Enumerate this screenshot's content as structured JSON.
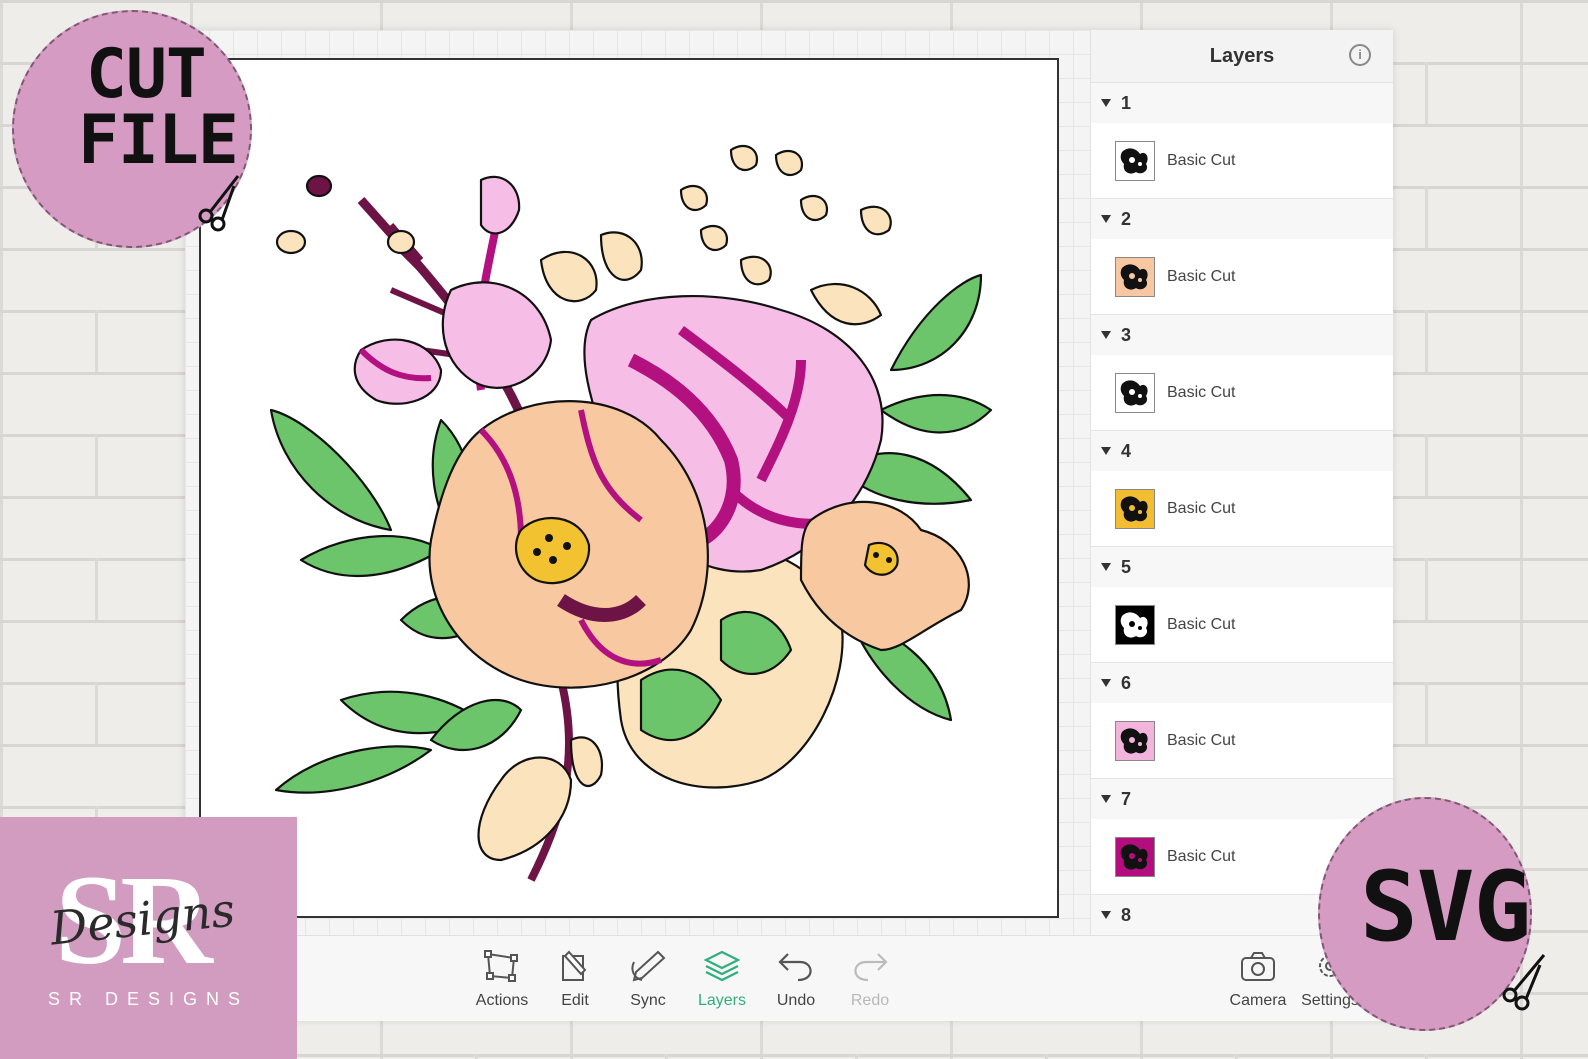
{
  "panel": {
    "title": "Layers",
    "info_icon": "info-icon",
    "groups": [
      {
        "number": "1",
        "layer": "Basic Cut",
        "thumb_color": "#ffffff"
      },
      {
        "number": "2",
        "layer": "Basic Cut",
        "thumb_color": "#f7c7a1"
      },
      {
        "number": "3",
        "layer": "Basic Cut",
        "thumb_color": "#ffffff"
      },
      {
        "number": "4",
        "layer": "Basic Cut",
        "thumb_color": "#f3bd32"
      },
      {
        "number": "5",
        "layer": "Basic Cut",
        "thumb_color": "#000000"
      },
      {
        "number": "6",
        "layer": "Basic Cut",
        "thumb_color": "#f2b4dc"
      },
      {
        "number": "7",
        "layer": "Basic Cut",
        "thumb_color": "#b30d7e"
      },
      {
        "number": "8"
      }
    ]
  },
  "toolbar": {
    "actions": "Actions",
    "edit": "Edit",
    "sync": "Sync",
    "layers": "Layers",
    "undo": "Undo",
    "redo": "Redo",
    "camera": "Camera",
    "settings": "Settings"
  },
  "badges": {
    "cut_file_line1": "CUT",
    "cut_file_line2": "FILE",
    "svg": "SVG"
  },
  "logo": {
    "initials": "SR",
    "script": "Designs",
    "name": "SR DESIGNS"
  },
  "colors": {
    "accent": "#2fae7e",
    "badge_pink": "#d69bc3",
    "logo_pink": "#d29cc1",
    "leaf_green": "#6cc56a",
    "peach": "#f8c8a0",
    "pink": "#f6bde6",
    "magenta": "#b3117f",
    "cream": "#fbe3bd",
    "yellow": "#f2c230",
    "plum": "#6e1346"
  }
}
